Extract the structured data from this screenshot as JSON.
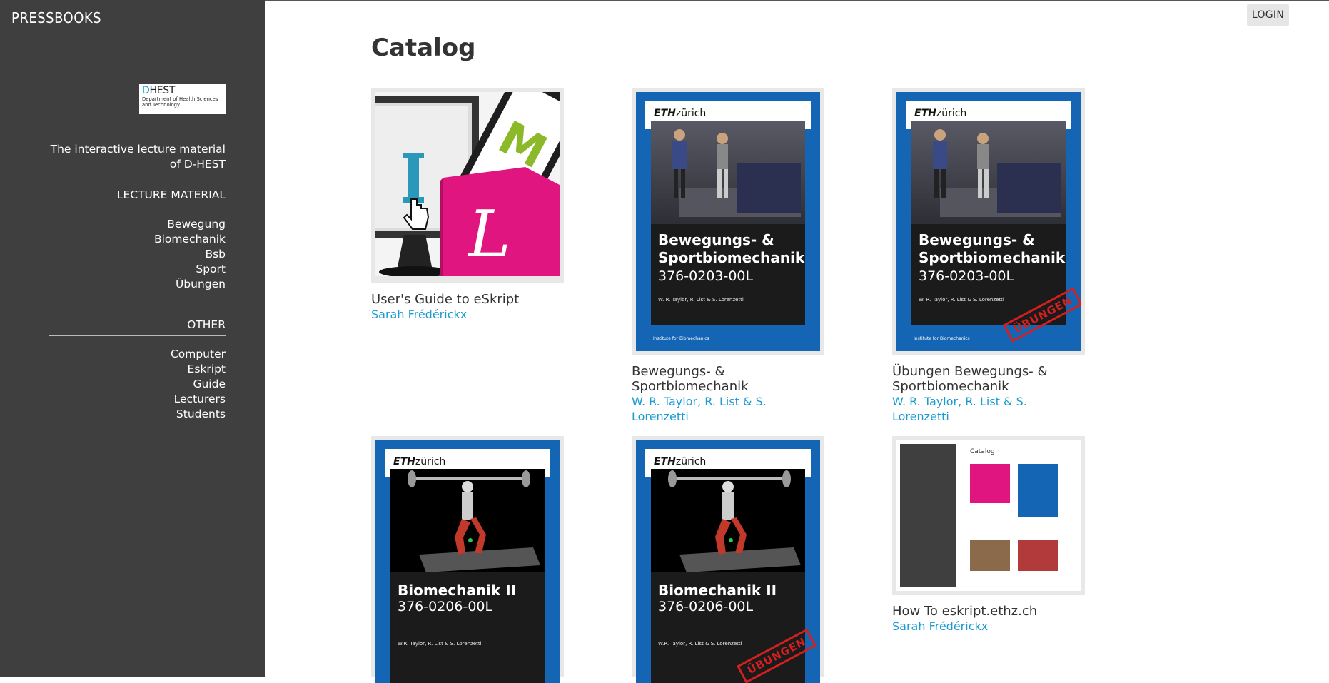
{
  "sidebar": {
    "brand": "PRESSBOOKS",
    "logo": {
      "big_d": "D",
      "big_rest": "HEST",
      "line1": "Department of Health Sciences",
      "line2": "and Technology"
    },
    "tagline": "The interactive lecture material of D-HEST",
    "sections": [
      {
        "heading": "LECTURE MATERIAL",
        "items": [
          "Bewegung",
          "Biomechanik",
          "Bsb",
          "Sport",
          "Übungen"
        ]
      },
      {
        "heading": "OTHER",
        "items": [
          "Computer",
          "Eskript",
          "Guide",
          "Lecturers",
          "Students"
        ]
      }
    ]
  },
  "header": {
    "login_label": "LOGIN"
  },
  "main": {
    "title": "Catalog",
    "books": [
      {
        "title": "User's Guide to eSkript",
        "author": "Sarah Frédérickx"
      },
      {
        "title": "Bewegungs- & Sportbiomechanik",
        "author": "W. R. Taylor, R. List & S. Lorenzetti",
        "cover": {
          "brand_eth": "ETH",
          "brand_zurich": "zürich",
          "title1": "Bewegungs- &",
          "title2": "Sportbiomechanik",
          "code": "376-0203-00L",
          "authors": "W. R. Taylor, R. List & S. Lorenzetti",
          "footer": "Institute for Biomechanics"
        }
      },
      {
        "title": "Übungen Bewegungs- & Sportbiomechanik",
        "author": "W. R. Taylor, R. List & S. Lorenzetti",
        "cover": {
          "brand_eth": "ETH",
          "brand_zurich": "zürich",
          "title1": "Bewegungs- &",
          "title2": "Sportbiomechanik",
          "code": "376-0203-00L",
          "authors": "W. R. Taylor, R. List & S. Lorenzetti",
          "footer": "Institute for Biomechanics",
          "stamp": "ÜBUNGEN"
        }
      },
      {
        "cover": {
          "brand_eth": "ETH",
          "brand_zurich": "zürich",
          "title1": "Biomechanik II",
          "code": "376-0206-00L",
          "authors": "W.R. Taylor, R. List & S. Lorenzetti"
        }
      },
      {
        "cover": {
          "brand_eth": "ETH",
          "brand_zurich": "zürich",
          "title1": "Biomechanik II",
          "code": "376-0206-00L",
          "authors": "W.R. Taylor, R. List & S. Lorenzetti",
          "stamp": "ÜBUNGEN"
        }
      },
      {
        "title": "How To eskript.ethz.ch",
        "author": "Sarah Frédérickx",
        "cover": {
          "mini_title": "Catalog"
        }
      }
    ]
  },
  "colors": {
    "sidebar_bg": "#3f3f3f",
    "author_link": "#1a9bd1",
    "eth_blue": "#1466b4",
    "stamp_red": "#d41f1f",
    "pink": "#e0157f"
  }
}
